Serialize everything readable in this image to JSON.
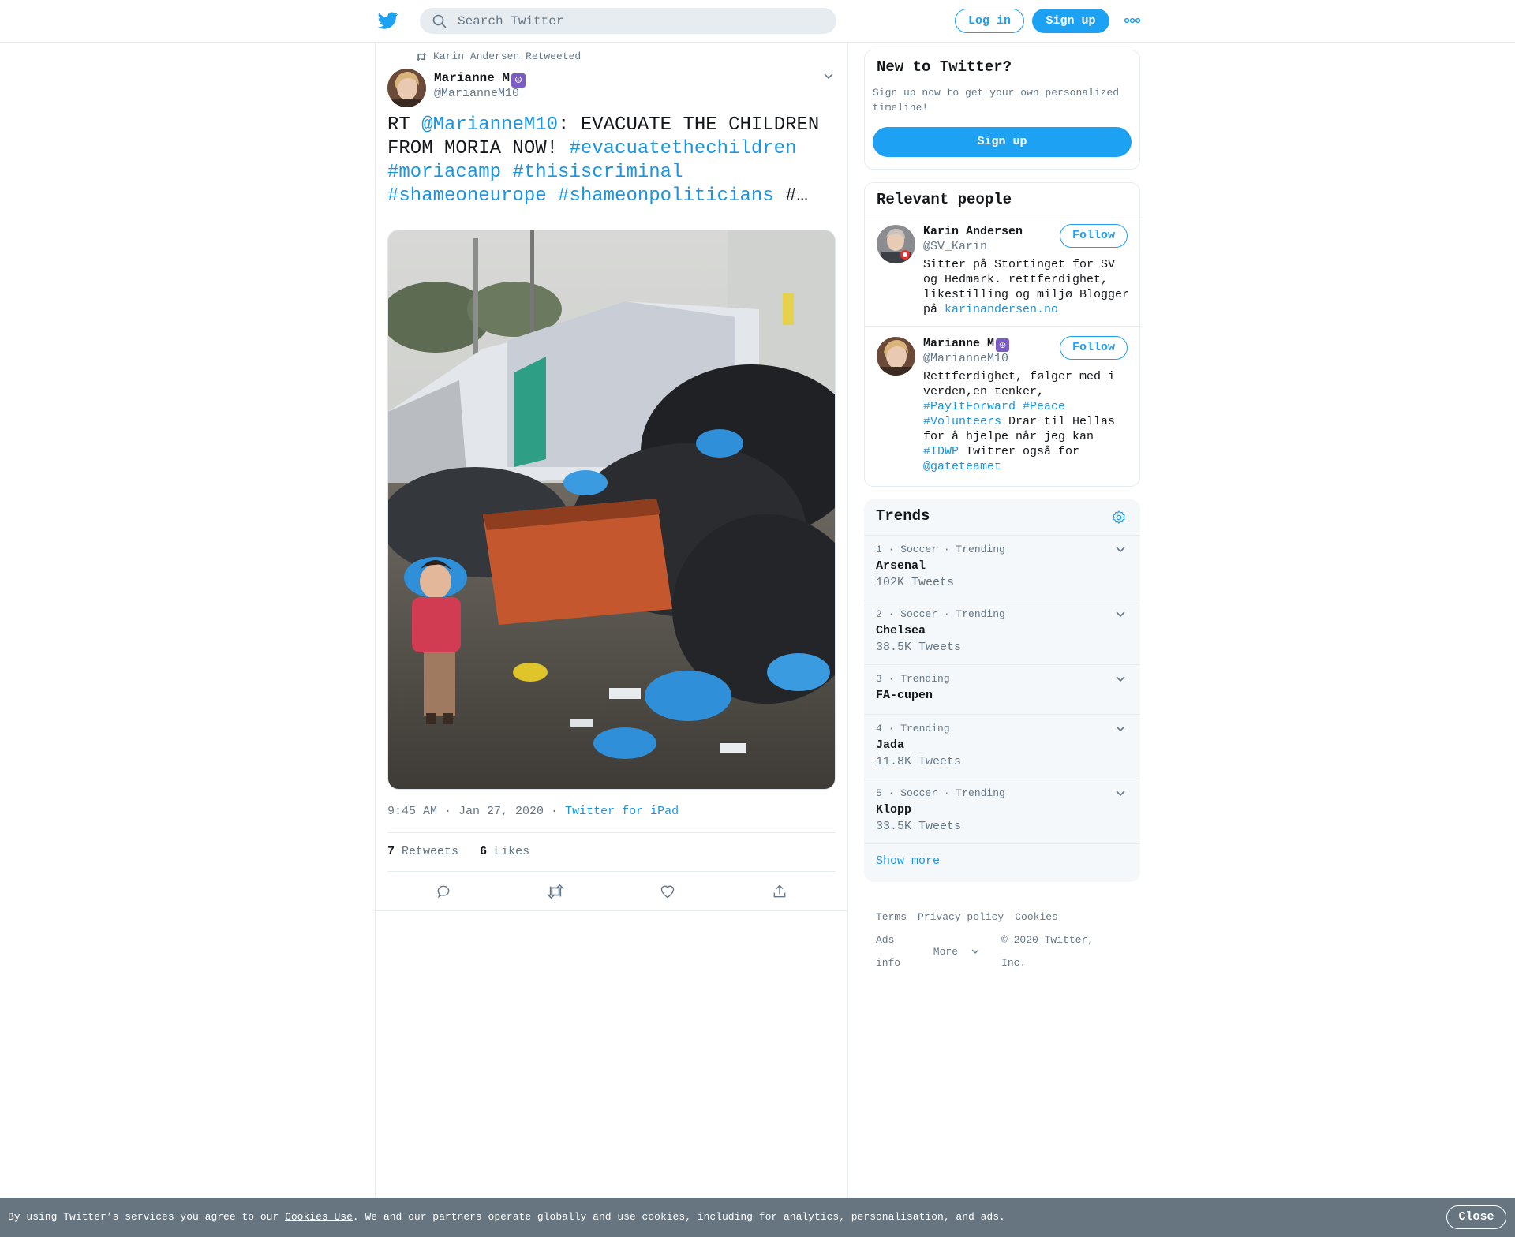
{
  "header": {
    "search_placeholder": "Search Twitter",
    "login_label": "Log in",
    "signup_label": "Sign up",
    "more_icon": "more-dots-icon",
    "brand_color": "#1da1f2"
  },
  "tweet": {
    "retweet_context": "Karin Andersen Retweeted",
    "author_name": "Marianne M",
    "author_emoji": "☮",
    "author_handle": "@MarianneM10",
    "text_prefix": "RT ",
    "mention": "@MarianneM10",
    "text_body": ": EVACUATE THE CHILDREN FROM MORIA NOW! ",
    "hashtags": [
      "#evacuatethechildren",
      "#moriacamp",
      "#thisiscriminal",
      "#shameoneurope",
      "#shameonpoliticians"
    ],
    "text_suffix": " #…",
    "time": "9:45 AM · Jan 27, 2020",
    "separator": " · ",
    "source": "Twitter for iPad",
    "retweet_count": "7",
    "retweet_label": "Retweets",
    "like_count": "6",
    "like_label": "Likes"
  },
  "new_to_twitter": {
    "title": "New to Twitter?",
    "description": "Sign up now to get your own personalized timeline!",
    "signup_label": "Sign up"
  },
  "relevant_people": {
    "title": "Relevant people",
    "people": [
      {
        "name": "Karin Andersen",
        "handle": "@SV_Karin",
        "follow_label": "Follow",
        "bio": "Sitter på Stortinget for SV og Hedmark. rettferdighet, likestilling og miljø Blogger på ",
        "bio_link": "karinandersen.no"
      },
      {
        "name": "Marianne M",
        "emoji": "☮",
        "handle": "@MarianneM10",
        "follow_label": "Follow",
        "bio_1": "Rettferdighet, følger med i verden,en tenker, ",
        "bio_tag_1": "#PayItForward",
        "bio_tag_2": "#Peace",
        "bio_tag_3": "#Volunteers",
        "bio_2": " Drar til Hellas for å hjelpe når jeg kan ",
        "bio_tag_4": "#IDWP",
        "bio_3": " Twitrer også for ",
        "bio_mention": "@gateteamet"
      }
    ]
  },
  "trends": {
    "title": "Trends",
    "items": [
      {
        "meta": "1 · Soccer · Trending",
        "name": "Arsenal",
        "count": "102K Tweets"
      },
      {
        "meta": "2 · Soccer · Trending",
        "name": "Chelsea",
        "count": "38.5K Tweets"
      },
      {
        "meta": "3 · Trending",
        "name": "FA-cupen",
        "count": ""
      },
      {
        "meta": "4 · Trending",
        "name": "Jada",
        "count": "11.8K Tweets"
      },
      {
        "meta": "5 · Soccer · Trending",
        "name": "Klopp",
        "count": "33.5K Tweets"
      }
    ],
    "show_more": "Show more"
  },
  "footer": {
    "terms": "Terms",
    "privacy": "Privacy policy",
    "cookies": "Cookies",
    "ads_info": "Ads info",
    "more": "More",
    "copyright": "© 2020 Twitter, Inc."
  },
  "cookie_bar": {
    "text_before": "By using Twitter’s services you agree to our ",
    "link": "Cookies Use",
    "text_after": ". We and our partners operate globally and use cookies, including for analytics, personalisation, and ads.",
    "close_label": "Close"
  }
}
